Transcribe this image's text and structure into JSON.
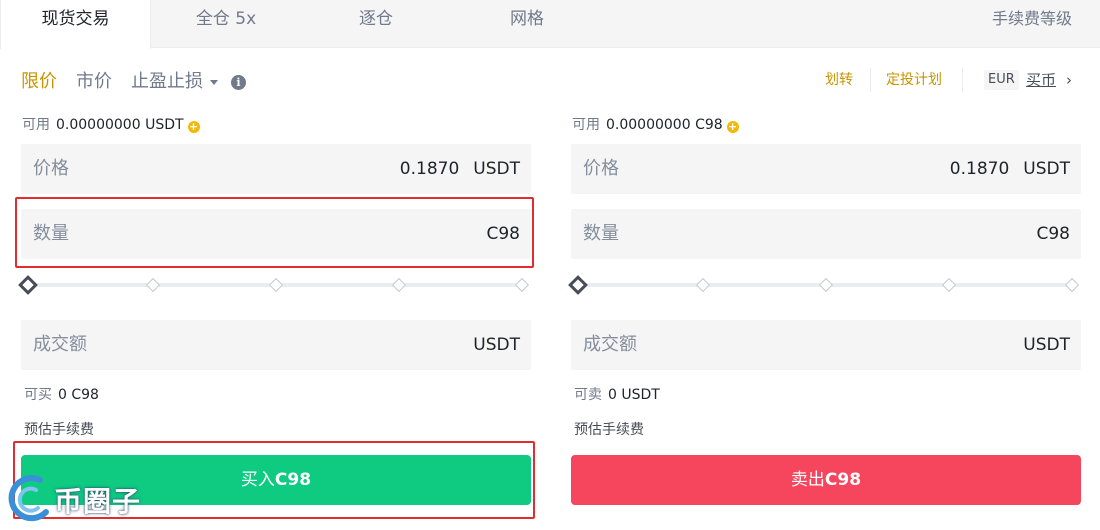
{
  "tabs": [
    {
      "label": "现货交易",
      "active": true
    },
    {
      "label": "全仓 5x",
      "active": false
    },
    {
      "label": "逐仓",
      "active": false
    },
    {
      "label": "网格",
      "active": false
    }
  ],
  "fee_level": "手续费等级",
  "order_types": {
    "limit": "限价",
    "market": "市价",
    "stop": "止盈止损",
    "active": "limit"
  },
  "links": {
    "transfer": "划转",
    "auto_invest": "定投计划",
    "currency": "EUR",
    "buy_coin": "买币"
  },
  "buy_panel": {
    "available_label": "可用",
    "available_value": "0.00000000 USDT",
    "price_label": "价格",
    "price_value": "0.1870",
    "price_unit": "USDT",
    "amount_label": "数量",
    "amount_unit": "C98",
    "slider_fraction": 0,
    "total_label": "成交额",
    "total_unit": "USDT",
    "max_label": "可买",
    "max_value": "0 C98",
    "fee_label": "预估手续费",
    "button_prefix": "买入",
    "button_asset": "C98"
  },
  "sell_panel": {
    "available_label": "可用",
    "available_value": "0.00000000 C98",
    "price_label": "价格",
    "price_value": "0.1870",
    "price_unit": "USDT",
    "amount_label": "数量",
    "amount_unit": "C98",
    "slider_fraction": 0,
    "total_label": "成交额",
    "total_unit": "USDT",
    "max_label": "可卖",
    "max_value": "0 USDT",
    "fee_label": "预估手续费",
    "button_prefix": "卖出",
    "button_asset": "C98"
  },
  "watermark": "币圈子",
  "colors": {
    "accent": "#c99400",
    "buy": "#0ecb81",
    "sell": "#f6465d",
    "highlight": "#e02e2e"
  }
}
